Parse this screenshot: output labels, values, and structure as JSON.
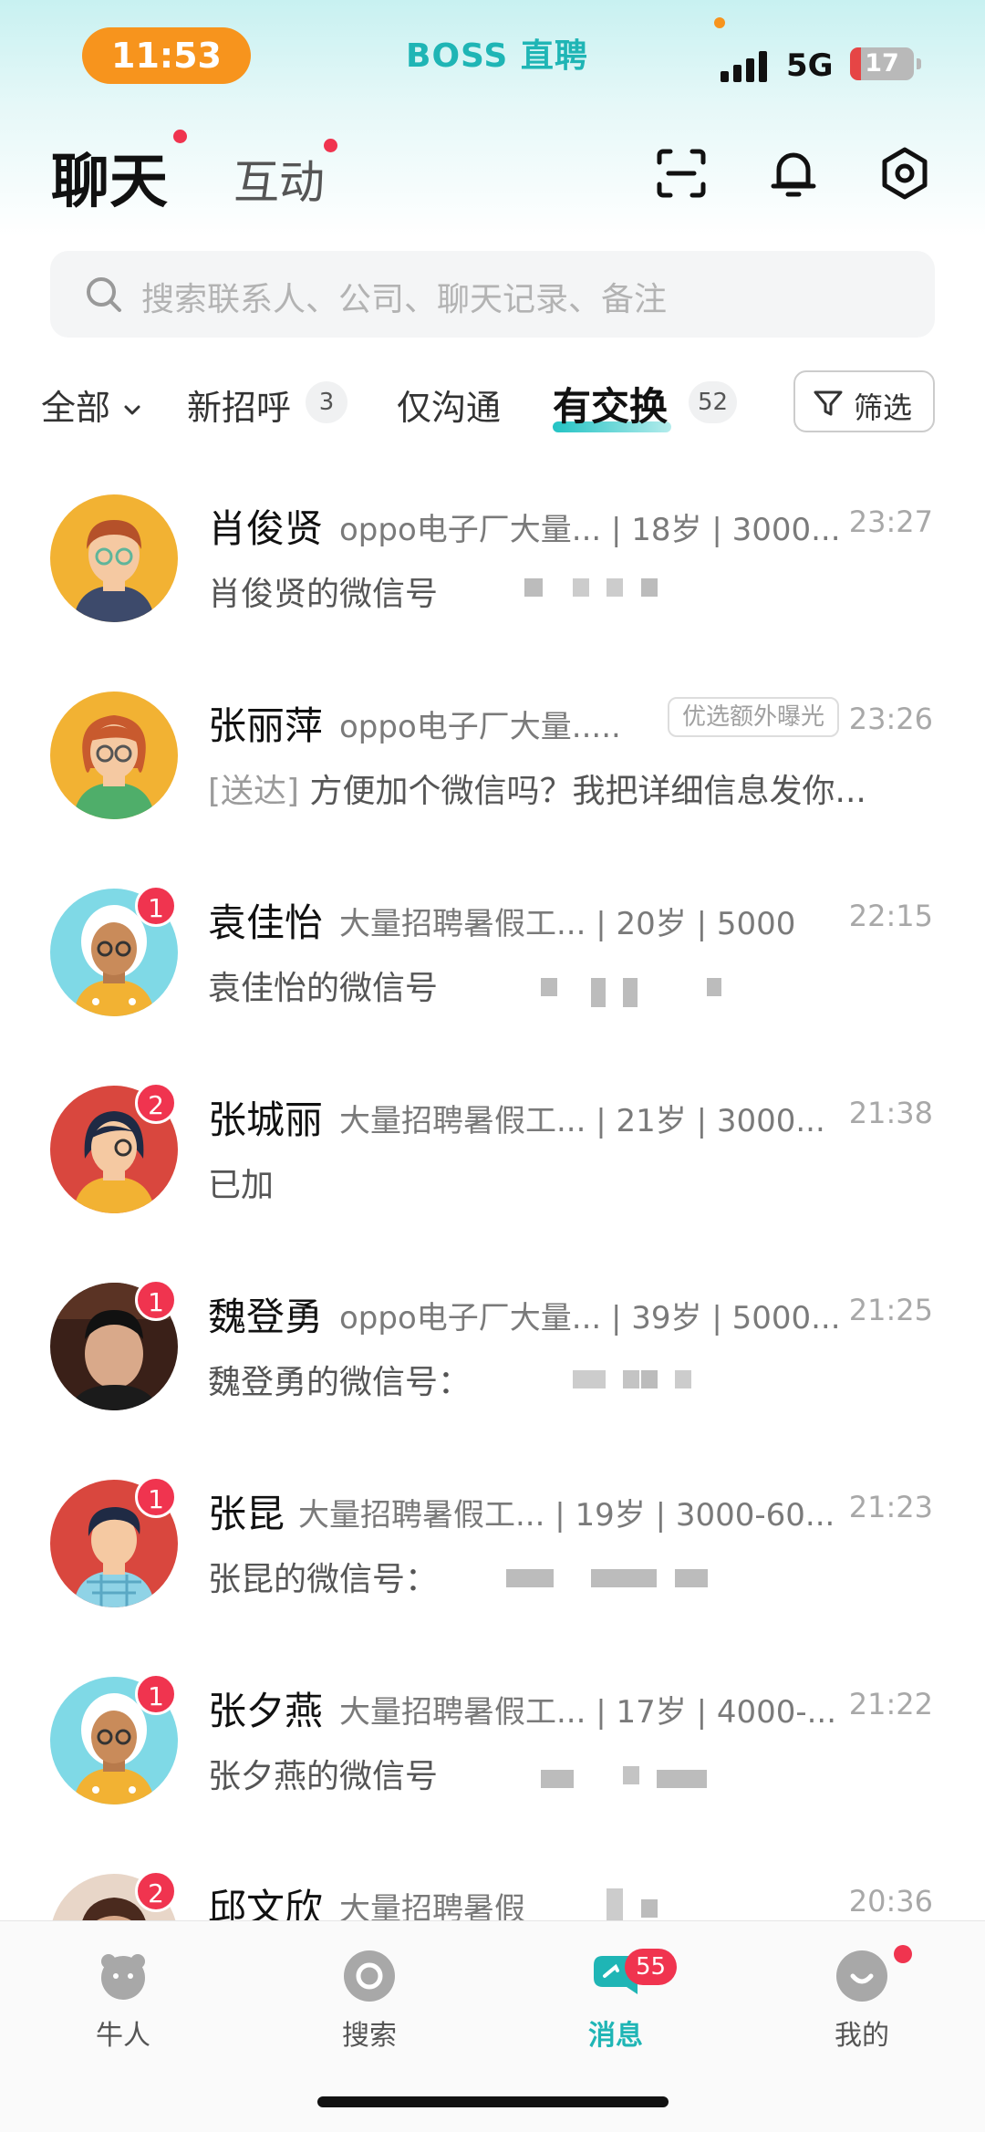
{
  "status_bar": {
    "time": "11:53",
    "carrier_label": "BOSS 直聘",
    "network": "5G",
    "battery": "17",
    "battery_level": 0.17
  },
  "header": {
    "tab_chat": "聊天",
    "tab_interaction": "互动"
  },
  "search": {
    "placeholder": "搜索联系人、公司、聊天记录、备注"
  },
  "filters": {
    "all": "全部",
    "new_greet": "新招呼",
    "new_greet_count": "3",
    "only_chat": "仅沟通",
    "exchanged": "有交换",
    "exchanged_count": "52",
    "filter_button": "筛选"
  },
  "chats": [
    {
      "name": "肖俊贤",
      "job": "oppo电子厂大量... | 18岁 | 3000...",
      "time": "23:27",
      "message": "肖俊贤的微信号",
      "status": "",
      "tag": "",
      "unread": ""
    },
    {
      "name": "张丽萍",
      "job": "oppo电子厂大量.....",
      "time": "23:26",
      "message": "方便加个微信吗？我把详细信息发你...",
      "status": "[送达]",
      "tag": "优选额外曝光",
      "unread": ""
    },
    {
      "name": "袁佳怡",
      "job": "大量招聘暑假工... | 20岁 | 5000",
      "time": "22:15",
      "message": "袁佳怡的微信号",
      "status": "",
      "tag": "",
      "unread": "1"
    },
    {
      "name": "张城丽",
      "job": "大量招聘暑假工... | 21岁 | 3000...",
      "time": "21:38",
      "message": "已加",
      "status": "",
      "tag": "",
      "unread": "2"
    },
    {
      "name": "魏登勇",
      "job": "oppo电子厂大量... | 39岁 | 5000...",
      "time": "21:25",
      "message": "魏登勇的微信号：",
      "status": "",
      "tag": "",
      "unread": "1"
    },
    {
      "name": "张昆",
      "job": "大量招聘暑假工... | 19岁 | 3000-60...",
      "time": "21:23",
      "message": "张昆的微信号：",
      "status": "",
      "tag": "",
      "unread": "1"
    },
    {
      "name": "张夕燕",
      "job": "大量招聘暑假工... | 17岁 | 4000-...",
      "time": "21:22",
      "message": "张夕燕的微信号",
      "status": "",
      "tag": "",
      "unread": "1"
    },
    {
      "name": "邱文欣",
      "job": "大量招聘暑假",
      "time": "20:36",
      "message": "",
      "status": "",
      "tag": "",
      "unread": "2"
    }
  ],
  "bottom_nav": [
    {
      "label": "牛人",
      "icon": "bear-icon"
    },
    {
      "label": "搜索",
      "icon": "search-disc-icon"
    },
    {
      "label": "消息",
      "icon": "message-icon",
      "badge": "55"
    },
    {
      "label": "我的",
      "icon": "profile-icon"
    }
  ],
  "colors": {
    "accent": "#1fb5b5",
    "badge": "#f0344f",
    "time_pill": "#f7941d"
  }
}
